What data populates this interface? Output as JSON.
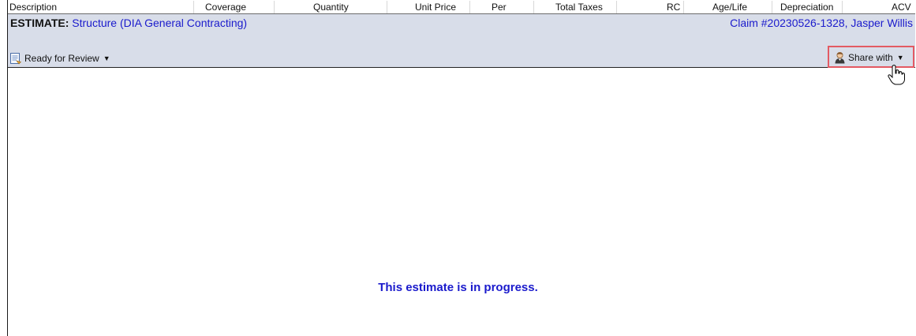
{
  "columns": {
    "description": "Description",
    "coverage": "Coverage",
    "quantity": "Quantity",
    "unit_price": "Unit Price",
    "per": "Per",
    "total_taxes": "Total Taxes",
    "rc": "RC",
    "age_life": "Age/Life",
    "depreciation": "Depreciation",
    "acv": "ACV"
  },
  "estimate": {
    "prefix": "ESTIMATE:",
    "name": "Structure (DIA General Contracting)",
    "claim": "Claim #20230526-1328, Jasper Willis",
    "status_label": "Ready for Review",
    "status_icon": "document-icon",
    "share_label": "Share with",
    "share_icon": "person-icon"
  },
  "message": "This estimate is in progress.",
  "colors": {
    "header_bar": "#d8dde9",
    "link_blue": "#1a1acc",
    "highlight_border": "#e35a63"
  }
}
